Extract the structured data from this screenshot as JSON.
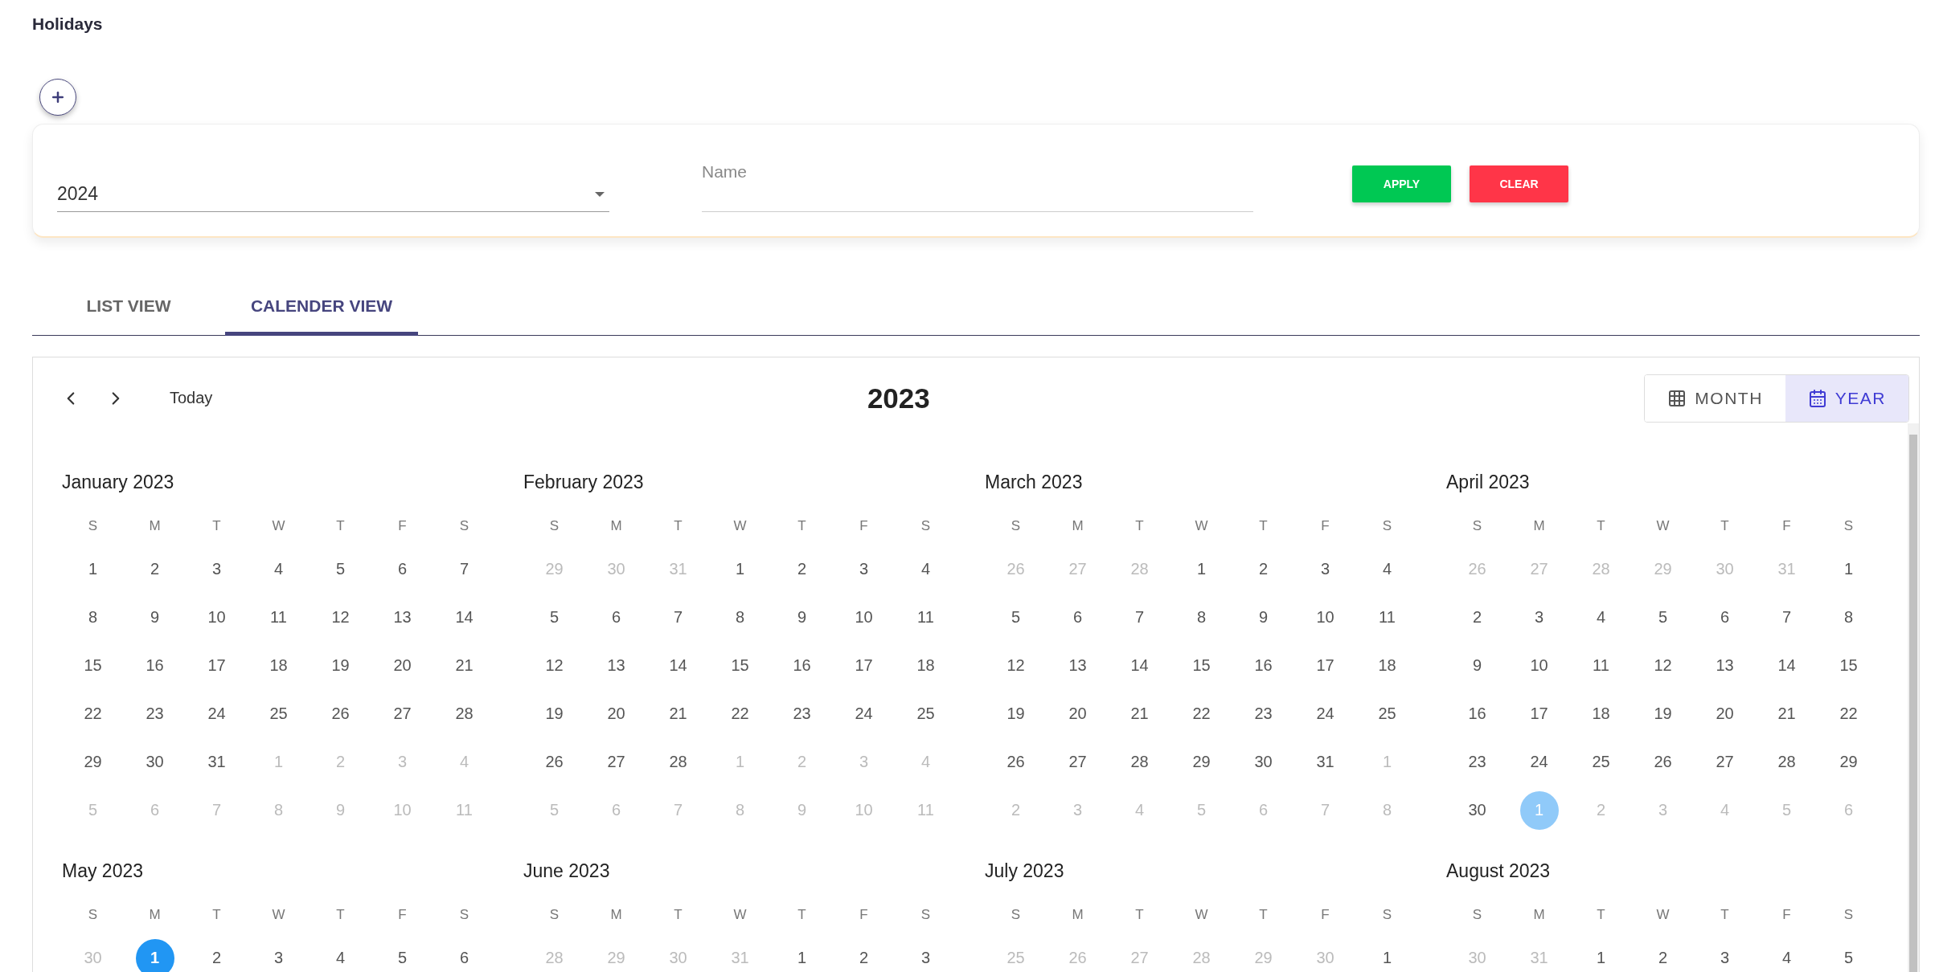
{
  "page_title": "Holidays",
  "filter": {
    "year": {
      "value": "2024"
    },
    "name": {
      "placeholder": "Name"
    },
    "buttons": [
      {
        "label": "APPLY",
        "kind": "apply"
      },
      {
        "label": "CLEAR",
        "kind": "clear"
      }
    ]
  },
  "tabs": [
    {
      "label": "LIST VIEW",
      "selected": false
    },
    {
      "label": "CALENDER VIEW",
      "selected": true
    }
  ],
  "calendar": {
    "today_label": "Today",
    "title": "2023",
    "views": [
      {
        "label": "MONTH",
        "kind": "month",
        "selected": false
      },
      {
        "label": "YEAR",
        "kind": "year",
        "selected": true
      }
    ],
    "months": [
      {
        "title": "January 2023",
        "weekdays": [
          "S",
          "M",
          "T",
          "W",
          "T",
          "F",
          "S"
        ],
        "weeks": [
          [
            {
              "d": "1",
              "out": false
            },
            {
              "d": "2",
              "out": false
            },
            {
              "d": "3",
              "out": false
            },
            {
              "d": "4",
              "out": false
            },
            {
              "d": "5",
              "out": false
            },
            {
              "d": "6",
              "out": false
            },
            {
              "d": "7",
              "out": false
            }
          ],
          [
            {
              "d": "8",
              "out": false
            },
            {
              "d": "9",
              "out": false
            },
            {
              "d": "10",
              "out": false
            },
            {
              "d": "11",
              "out": false
            },
            {
              "d": "12",
              "out": false
            },
            {
              "d": "13",
              "out": false
            },
            {
              "d": "14",
              "out": false
            }
          ],
          [
            {
              "d": "15",
              "out": false
            },
            {
              "d": "16",
              "out": false
            },
            {
              "d": "17",
              "out": false
            },
            {
              "d": "18",
              "out": false
            },
            {
              "d": "19",
              "out": false
            },
            {
              "d": "20",
              "out": false
            },
            {
              "d": "21",
              "out": false
            }
          ],
          [
            {
              "d": "22",
              "out": false
            },
            {
              "d": "23",
              "out": false
            },
            {
              "d": "24",
              "out": false
            },
            {
              "d": "25",
              "out": false
            },
            {
              "d": "26",
              "out": false
            },
            {
              "d": "27",
              "out": false
            },
            {
              "d": "28",
              "out": false
            }
          ],
          [
            {
              "d": "29",
              "out": false
            },
            {
              "d": "30",
              "out": false
            },
            {
              "d": "31",
              "out": false
            },
            {
              "d": "1",
              "out": true
            },
            {
              "d": "2",
              "out": true
            },
            {
              "d": "3",
              "out": true
            },
            {
              "d": "4",
              "out": true
            }
          ],
          [
            {
              "d": "5",
              "out": true
            },
            {
              "d": "6",
              "out": true
            },
            {
              "d": "7",
              "out": true
            },
            {
              "d": "8",
              "out": true
            },
            {
              "d": "9",
              "out": true
            },
            {
              "d": "10",
              "out": true
            },
            {
              "d": "11",
              "out": true
            }
          ]
        ]
      },
      {
        "title": "February 2023",
        "weekdays": [
          "S",
          "M",
          "T",
          "W",
          "T",
          "F",
          "S"
        ],
        "weeks": [
          [
            {
              "d": "29",
              "out": true
            },
            {
              "d": "30",
              "out": true
            },
            {
              "d": "31",
              "out": true
            },
            {
              "d": "1",
              "out": false
            },
            {
              "d": "2",
              "out": false
            },
            {
              "d": "3",
              "out": false
            },
            {
              "d": "4",
              "out": false
            }
          ],
          [
            {
              "d": "5",
              "out": false
            },
            {
              "d": "6",
              "out": false
            },
            {
              "d": "7",
              "out": false
            },
            {
              "d": "8",
              "out": false
            },
            {
              "d": "9",
              "out": false
            },
            {
              "d": "10",
              "out": false
            },
            {
              "d": "11",
              "out": false
            }
          ],
          [
            {
              "d": "12",
              "out": false
            },
            {
              "d": "13",
              "out": false
            },
            {
              "d": "14",
              "out": false
            },
            {
              "d": "15",
              "out": false
            },
            {
              "d": "16",
              "out": false
            },
            {
              "d": "17",
              "out": false
            },
            {
              "d": "18",
              "out": false
            }
          ],
          [
            {
              "d": "19",
              "out": false
            },
            {
              "d": "20",
              "out": false
            },
            {
              "d": "21",
              "out": false
            },
            {
              "d": "22",
              "out": false
            },
            {
              "d": "23",
              "out": false
            },
            {
              "d": "24",
              "out": false
            },
            {
              "d": "25",
              "out": false
            }
          ],
          [
            {
              "d": "26",
              "out": false
            },
            {
              "d": "27",
              "out": false
            },
            {
              "d": "28",
              "out": false
            },
            {
              "d": "1",
              "out": true
            },
            {
              "d": "2",
              "out": true
            },
            {
              "d": "3",
              "out": true
            },
            {
              "d": "4",
              "out": true
            }
          ],
          [
            {
              "d": "5",
              "out": true
            },
            {
              "d": "6",
              "out": true
            },
            {
              "d": "7",
              "out": true
            },
            {
              "d": "8",
              "out": true
            },
            {
              "d": "9",
              "out": true
            },
            {
              "d": "10",
              "out": true
            },
            {
              "d": "11",
              "out": true
            }
          ]
        ]
      },
      {
        "title": "March 2023",
        "weekdays": [
          "S",
          "M",
          "T",
          "W",
          "T",
          "F",
          "S"
        ],
        "weeks": [
          [
            {
              "d": "26",
              "out": true
            },
            {
              "d": "27",
              "out": true
            },
            {
              "d": "28",
              "out": true
            },
            {
              "d": "1",
              "out": false
            },
            {
              "d": "2",
              "out": false
            },
            {
              "d": "3",
              "out": false
            },
            {
              "d": "4",
              "out": false
            }
          ],
          [
            {
              "d": "5",
              "out": false
            },
            {
              "d": "6",
              "out": false
            },
            {
              "d": "7",
              "out": false
            },
            {
              "d": "8",
              "out": false
            },
            {
              "d": "9",
              "out": false
            },
            {
              "d": "10",
              "out": false
            },
            {
              "d": "11",
              "out": false
            }
          ],
          [
            {
              "d": "12",
              "out": false
            },
            {
              "d": "13",
              "out": false
            },
            {
              "d": "14",
              "out": false
            },
            {
              "d": "15",
              "out": false
            },
            {
              "d": "16",
              "out": false
            },
            {
              "d": "17",
              "out": false
            },
            {
              "d": "18",
              "out": false
            }
          ],
          [
            {
              "d": "19",
              "out": false
            },
            {
              "d": "20",
              "out": false
            },
            {
              "d": "21",
              "out": false
            },
            {
              "d": "22",
              "out": false
            },
            {
              "d": "23",
              "out": false
            },
            {
              "d": "24",
              "out": false
            },
            {
              "d": "25",
              "out": false
            }
          ],
          [
            {
              "d": "26",
              "out": false
            },
            {
              "d": "27",
              "out": false
            },
            {
              "d": "28",
              "out": false
            },
            {
              "d": "29",
              "out": false
            },
            {
              "d": "30",
              "out": false
            },
            {
              "d": "31",
              "out": false
            },
            {
              "d": "1",
              "out": true
            }
          ],
          [
            {
              "d": "2",
              "out": true
            },
            {
              "d": "3",
              "out": true
            },
            {
              "d": "4",
              "out": true
            },
            {
              "d": "5",
              "out": true
            },
            {
              "d": "6",
              "out": true
            },
            {
              "d": "7",
              "out": true
            },
            {
              "d": "8",
              "out": true
            }
          ]
        ]
      },
      {
        "title": "April 2023",
        "weekdays": [
          "S",
          "M",
          "T",
          "W",
          "T",
          "F",
          "S"
        ],
        "weeks": [
          [
            {
              "d": "26",
              "out": true
            },
            {
              "d": "27",
              "out": true
            },
            {
              "d": "28",
              "out": true
            },
            {
              "d": "29",
              "out": true
            },
            {
              "d": "30",
              "out": true
            },
            {
              "d": "31",
              "out": true
            },
            {
              "d": "1",
              "out": false
            }
          ],
          [
            {
              "d": "2",
              "out": false
            },
            {
              "d": "3",
              "out": false
            },
            {
              "d": "4",
              "out": false
            },
            {
              "d": "5",
              "out": false
            },
            {
              "d": "6",
              "out": false
            },
            {
              "d": "7",
              "out": false
            },
            {
              "d": "8",
              "out": false
            }
          ],
          [
            {
              "d": "9",
              "out": false
            },
            {
              "d": "10",
              "out": false
            },
            {
              "d": "11",
              "out": false
            },
            {
              "d": "12",
              "out": false
            },
            {
              "d": "13",
              "out": false
            },
            {
              "d": "14",
              "out": false
            },
            {
              "d": "15",
              "out": false
            }
          ],
          [
            {
              "d": "16",
              "out": false
            },
            {
              "d": "17",
              "out": false
            },
            {
              "d": "18",
              "out": false
            },
            {
              "d": "19",
              "out": false
            },
            {
              "d": "20",
              "out": false
            },
            {
              "d": "21",
              "out": false
            },
            {
              "d": "22",
              "out": false
            }
          ],
          [
            {
              "d": "23",
              "out": false
            },
            {
              "d": "24",
              "out": false
            },
            {
              "d": "25",
              "out": false
            },
            {
              "d": "26",
              "out": false
            },
            {
              "d": "27",
              "out": false
            },
            {
              "d": "28",
              "out": false
            },
            {
              "d": "29",
              "out": false
            }
          ],
          [
            {
              "d": "30",
              "out": false
            },
            {
              "d": "1",
              "out": true,
              "color": "#90caf9"
            },
            {
              "d": "2",
              "out": true
            },
            {
              "d": "3",
              "out": true
            },
            {
              "d": "4",
              "out": true
            },
            {
              "d": "5",
              "out": true
            },
            {
              "d": "6",
              "out": true
            }
          ]
        ]
      },
      {
        "title": "May 2023",
        "weekdays": [
          "S",
          "M",
          "T",
          "W",
          "T",
          "F",
          "S"
        ],
        "weeks": [
          [
            {
              "d": "30",
              "out": true
            },
            {
              "d": "1",
              "out": false,
              "color": "#2196f3"
            },
            {
              "d": "2",
              "out": false
            },
            {
              "d": "3",
              "out": false
            },
            {
              "d": "4",
              "out": false
            },
            {
              "d": "5",
              "out": false
            },
            {
              "d": "6",
              "out": false
            }
          ]
        ]
      },
      {
        "title": "June 2023",
        "weekdays": [
          "S",
          "M",
          "T",
          "W",
          "T",
          "F",
          "S"
        ],
        "weeks": [
          [
            {
              "d": "28",
              "out": true
            },
            {
              "d": "29",
              "out": true
            },
            {
              "d": "30",
              "out": true
            },
            {
              "d": "31",
              "out": true
            },
            {
              "d": "1",
              "out": false
            },
            {
              "d": "2",
              "out": false
            },
            {
              "d": "3",
              "out": false
            }
          ]
        ]
      },
      {
        "title": "July 2023",
        "weekdays": [
          "S",
          "M",
          "T",
          "W",
          "T",
          "F",
          "S"
        ],
        "weeks": [
          [
            {
              "d": "25",
              "out": true
            },
            {
              "d": "26",
              "out": true
            },
            {
              "d": "27",
              "out": true
            },
            {
              "d": "28",
              "out": true
            },
            {
              "d": "29",
              "out": true
            },
            {
              "d": "30",
              "out": true
            },
            {
              "d": "1",
              "out": false
            }
          ]
        ]
      },
      {
        "title": "August 2023",
        "weekdays": [
          "S",
          "M",
          "T",
          "W",
          "T",
          "F",
          "S"
        ],
        "weeks": [
          [
            {
              "d": "30",
              "out": true
            },
            {
              "d": "31",
              "out": true
            },
            {
              "d": "1",
              "out": false
            },
            {
              "d": "2",
              "out": false
            },
            {
              "d": "3",
              "out": false
            },
            {
              "d": "4",
              "out": false
            },
            {
              "d": "5",
              "out": false
            }
          ]
        ]
      }
    ]
  }
}
